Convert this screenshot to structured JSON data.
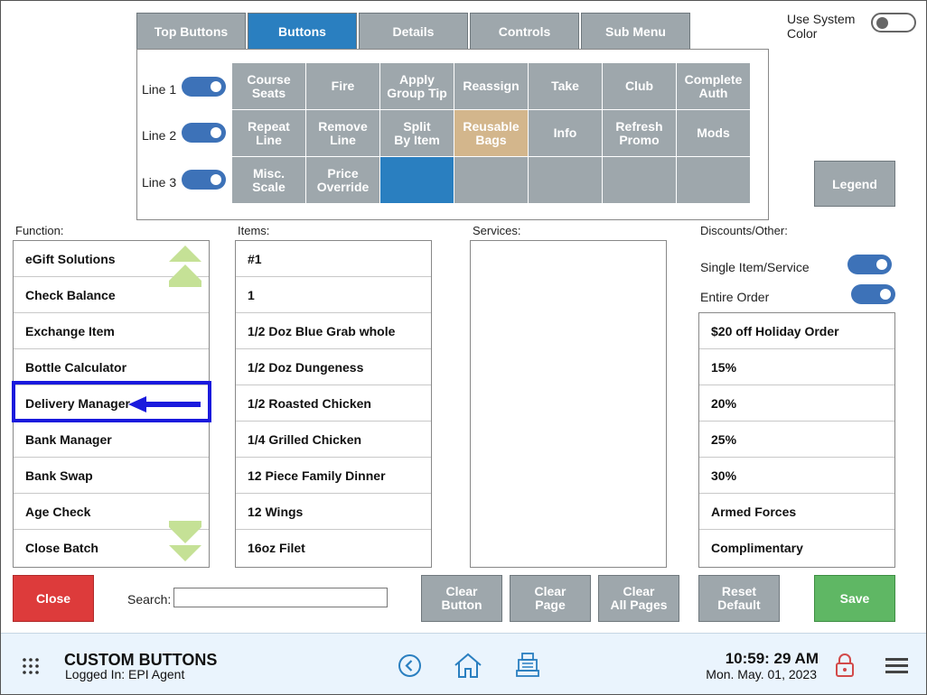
{
  "tabs": [
    {
      "label": "Top Buttons",
      "active": false
    },
    {
      "label": "Buttons",
      "active": true
    },
    {
      "label": "Details",
      "active": false
    },
    {
      "label": "Controls",
      "active": false
    },
    {
      "label": "Sub Menu",
      "active": false
    }
  ],
  "system_color": {
    "label": "Use System\nColor",
    "enabled": false
  },
  "lines": [
    {
      "label": "Line 1",
      "enabled": true
    },
    {
      "label": "Line 2",
      "enabled": true
    },
    {
      "label": "Line 3",
      "enabled": true
    }
  ],
  "grid_buttons": [
    [
      "Course\nSeats",
      "Fire",
      "Apply\nGroup Tip",
      "Reassign",
      "Take",
      "Club",
      "Complete\nAuth"
    ],
    [
      "Repeat\nLine",
      "Remove\nLine",
      "Split\nBy Item",
      "Reusable\nBags",
      "Info",
      "Refresh\nPromo",
      "Mods"
    ],
    [
      "Misc.\nScale",
      "Price\nOverride",
      "",
      "",
      "",
      "",
      ""
    ]
  ],
  "legend_label": "Legend",
  "sections": {
    "function": "Function:",
    "items": "Items:",
    "services": "Services:",
    "discounts": "Discounts/Other:"
  },
  "function_list": [
    "eGift Solutions",
    "Check Balance",
    "Exchange Item",
    "Bottle Calculator",
    "Delivery Manager",
    "Bank Manager",
    "Bank Swap",
    "Age Check",
    "Close Batch"
  ],
  "items_list": [
    "#1",
    "1",
    "1/2 Doz Blue Grab whole",
    "1/2 Doz Dungeness",
    "1/2 Roasted Chicken",
    "1/4 Grilled Chicken",
    "12 Piece Family Dinner",
    "12 Wings",
    "16oz Filet"
  ],
  "discount_toggles": [
    {
      "label": "Single Item/Service",
      "enabled": true
    },
    {
      "label": "Entire Order",
      "enabled": true
    }
  ],
  "discounts_list": [
    "$20 off Holiday Order",
    "15%",
    "20%",
    "25%",
    "30%",
    "Armed Forces",
    "Complimentary"
  ],
  "actions": {
    "close": "Close",
    "search_label": "Search:",
    "search_value": "",
    "clear_button": "Clear\nButton",
    "clear_page": "Clear\nPage",
    "clear_all_pages": "Clear\nAll Pages",
    "reset_default": "Reset\nDefault",
    "save": "Save"
  },
  "footer": {
    "title": "CUSTOM BUTTONS",
    "logged_in": "Logged In:  EPI Agent",
    "time": "10:59: 29 AM",
    "date": "Mon. May. 01, 2023"
  },
  "icons": [
    "apps-grid-icon",
    "back-circle-icon",
    "home-icon",
    "register-icon",
    "lock-icon",
    "hamburger-menu-icon"
  ],
  "colors": {
    "active_tab": "#2a7fc0",
    "button_gray": "#9ea7ac",
    "reusable_bags": "#d3b68c",
    "close_red": "#dd3b3b",
    "save_green": "#5fb764",
    "toggle_blue": "#3d72b8",
    "scroll_arrow": "#c5e196",
    "highlight": "#1a1add"
  }
}
